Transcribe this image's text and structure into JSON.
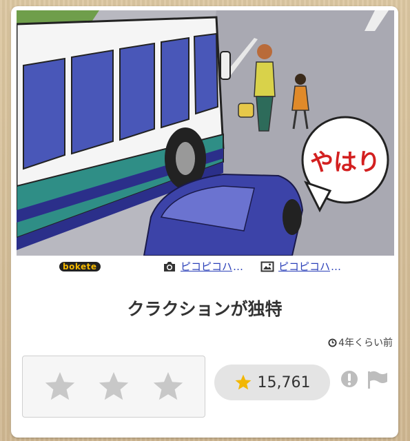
{
  "post": {
    "caption": "クラクションが独特",
    "posted_ago": "4年くらい前",
    "rating_count": "15,761"
  },
  "image_text": {
    "speech_bubble": "やはり"
  },
  "credits": {
    "logo": "bokete",
    "photo_author": "ピコピコハ",
    "image_author": "ピコピコハ",
    "ellipsis": "…"
  },
  "colors": {
    "star_empty": "#c8c8c8",
    "star_filled": "#f2b705",
    "link": "#2a3fb8",
    "icon_gray": "#bdbdbd"
  },
  "icons": {
    "photo_credit": "camera-icon",
    "image_credit": "image-icon",
    "time": "clock-icon",
    "report": "exclamation-icon",
    "flag": "flag-icon"
  }
}
